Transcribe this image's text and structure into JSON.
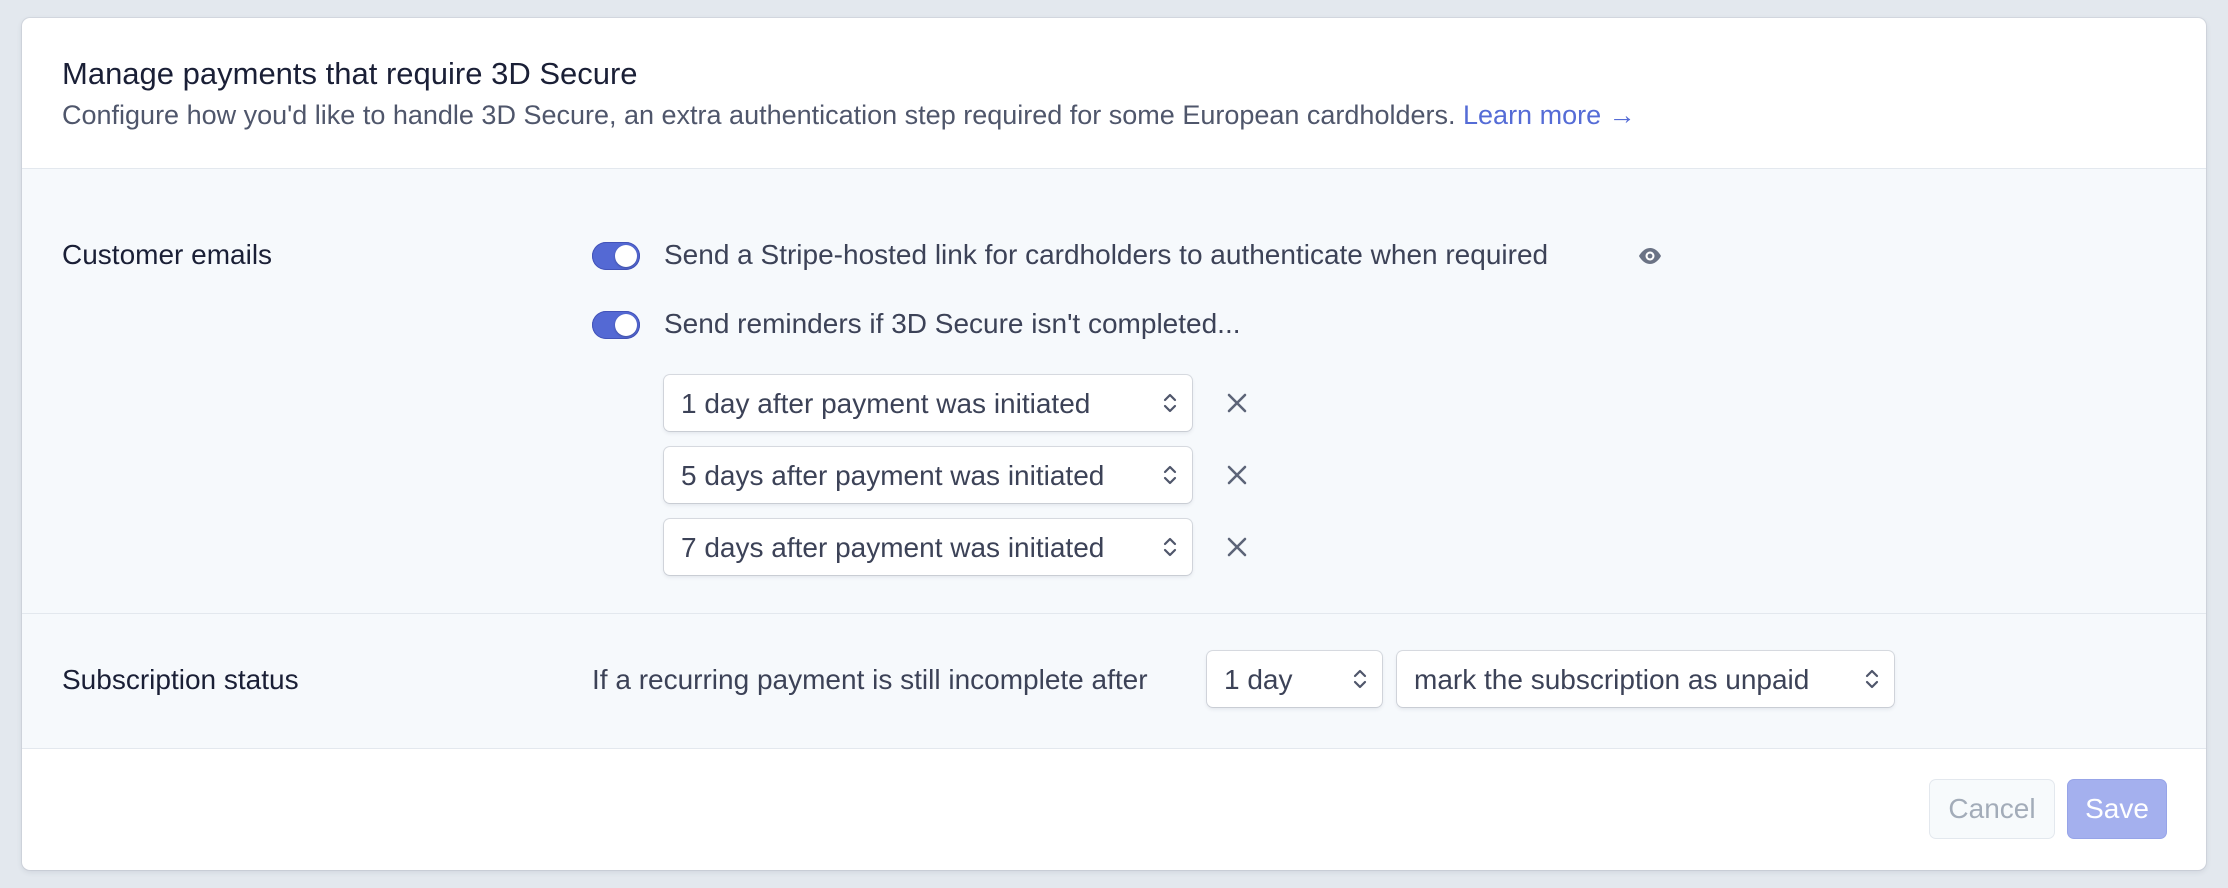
{
  "header": {
    "title": "Manage payments that require 3D Secure",
    "subtitle": "Configure how you'd like to handle 3D Secure, an extra authentication step required for some European cardholders.",
    "learn_more": "Learn more",
    "learn_more_arrow": "→"
  },
  "customer_emails": {
    "label": "Customer emails",
    "toggles": [
      {
        "text": "Send a Stripe-hosted link for cardholders to authenticate when required",
        "on": true
      },
      {
        "text": "Send reminders if 3D Secure isn't completed...",
        "on": true
      }
    ],
    "reminders": [
      "1 day after payment was initiated",
      "5 days after payment was initiated",
      "7 days after payment was initiated"
    ]
  },
  "subscription_status": {
    "label": "Subscription status",
    "text": "If a recurring payment is still incomplete after",
    "delay": "1 day",
    "action": "mark the subscription as unpaid"
  },
  "footer": {
    "cancel": "Cancel",
    "save": "Save"
  },
  "colors": {
    "accent": "#5469d4",
    "link": "#556cd6",
    "save_disabled": "#a4b0ee"
  },
  "icons": {
    "preview": "eye-icon",
    "remove": "close-icon",
    "select": "chevron-up-down-icon",
    "arrow": "arrow-right-icon"
  }
}
